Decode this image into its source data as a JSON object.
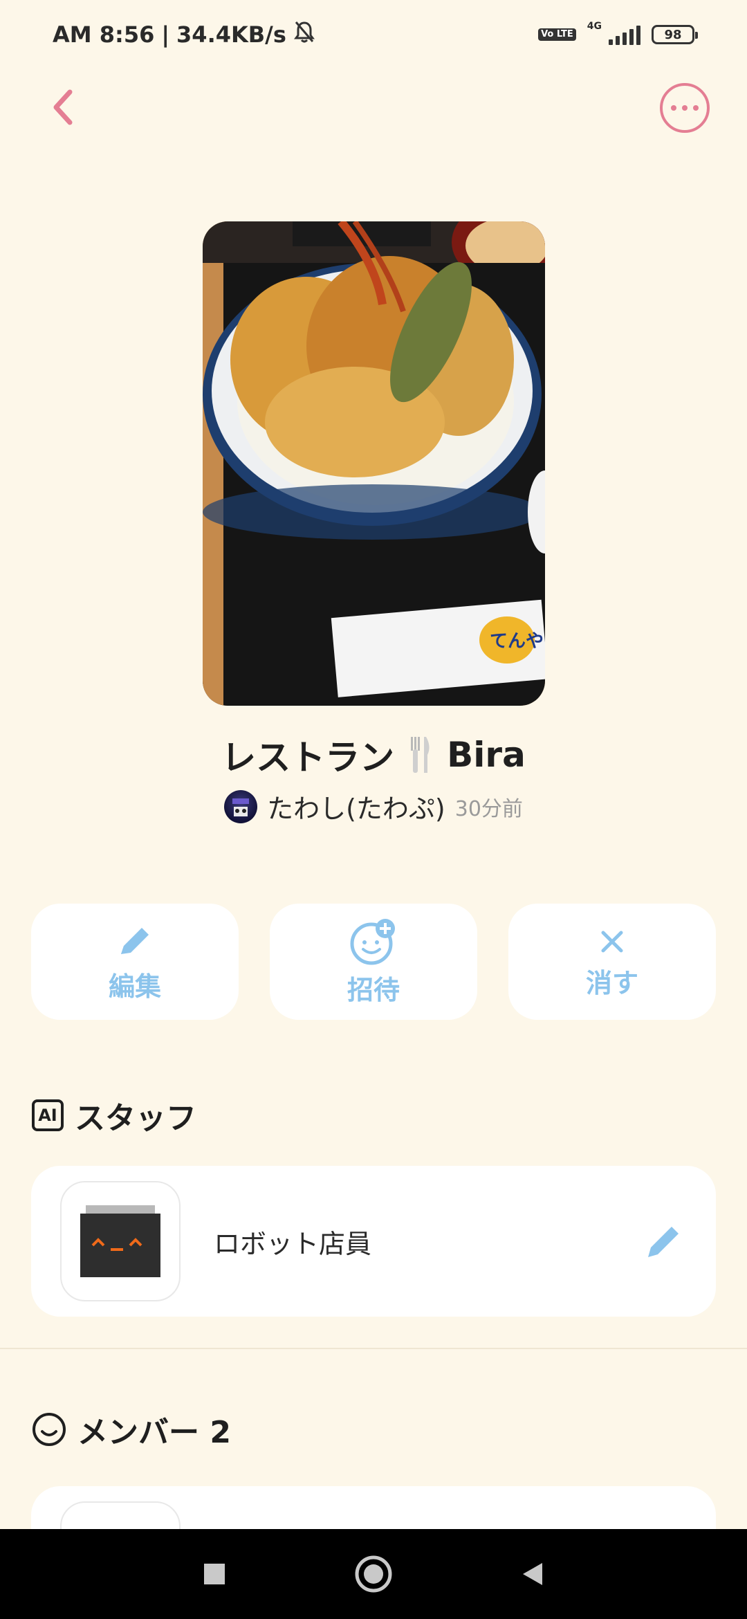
{
  "status": {
    "time": "AM 8:56",
    "speed": "34.4KB/s",
    "volte": "Vo LTE",
    "network": "4G",
    "battery": "98"
  },
  "room": {
    "title": "レストラン",
    "subtitle_name": "Bira",
    "owner_name": "たわし(たわぷ)",
    "time_ago": "30分前"
  },
  "actions": [
    {
      "label": "編集",
      "icon": "pencil-icon"
    },
    {
      "label": "招待",
      "icon": "invite-face-icon"
    },
    {
      "label": "消す",
      "icon": "close-icon"
    }
  ],
  "staff_section": {
    "badge": "AI",
    "title": "スタッフ",
    "items": [
      {
        "name": "ロボット店員"
      }
    ]
  },
  "member_section": {
    "title": "メンバー 2"
  },
  "colors": {
    "background": "#fdf7e9",
    "accent_pink": "#e47e93",
    "accent_blue": "#8cc4ec"
  }
}
